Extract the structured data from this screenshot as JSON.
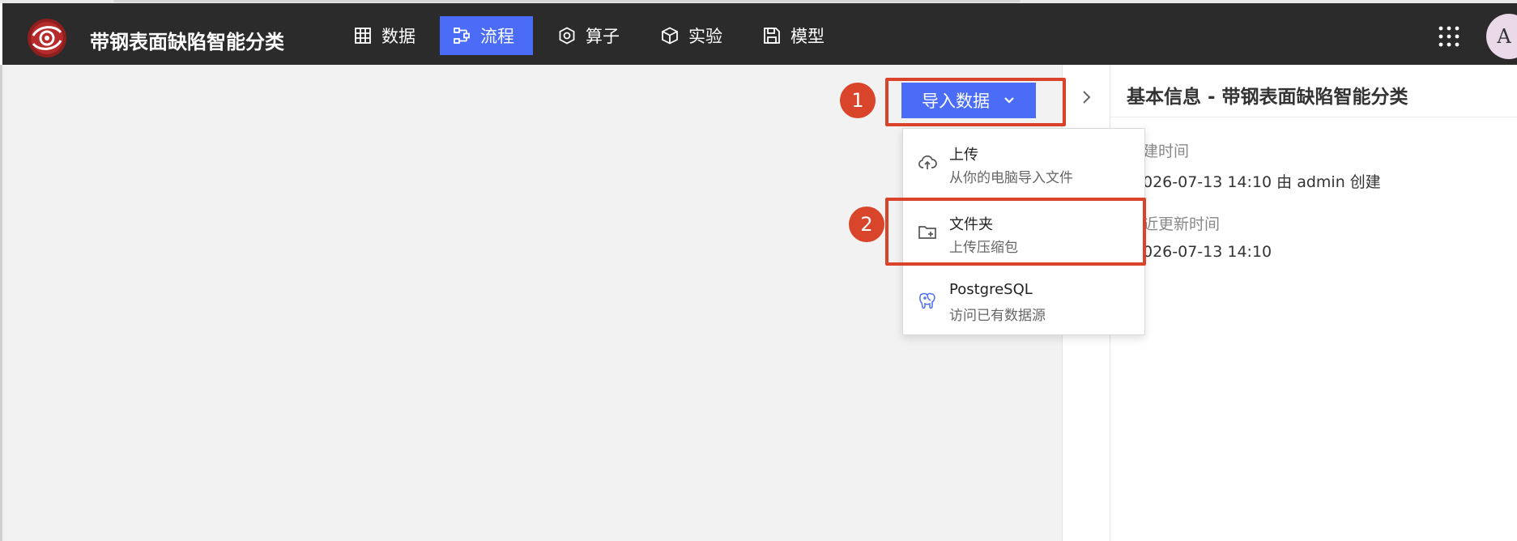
{
  "app": {
    "title": "带钢表面缺陷智能分类"
  },
  "nav": {
    "items": [
      {
        "label": "数据",
        "icon": "table-icon",
        "active": false
      },
      {
        "label": "流程",
        "icon": "flow-icon",
        "active": true
      },
      {
        "label": "算子",
        "icon": "hexagon-icon",
        "active": false
      },
      {
        "label": "实验",
        "icon": "cube-icon",
        "active": false
      },
      {
        "label": "模型",
        "icon": "save-icon",
        "active": false
      }
    ],
    "avatar_initial": "A"
  },
  "toolbar": {
    "import_label": "导入数据"
  },
  "dropdown": {
    "items": [
      {
        "title": "上传",
        "desc": "从你的电脑导入文件",
        "icon": "cloud-upload-icon"
      },
      {
        "title": "文件夹",
        "desc": "上传压缩包",
        "icon": "folder-add-icon"
      },
      {
        "title": "PostgreSQL",
        "desc": "访问已有数据源",
        "icon": "postgresql-icon"
      }
    ]
  },
  "annotations": {
    "step1": "1",
    "step2": "2"
  },
  "panel": {
    "title": "基本信息 - 带钢表面缺陷智能分类",
    "created_label": "建时间",
    "created_value": "026-07-13 14:10  由 admin 创建",
    "updated_label": "近更新时间",
    "updated_value": "026-07-13 14:10"
  },
  "colors": {
    "navbar": "#2b2b2b",
    "accent": "#4a6cf7",
    "highlight": "#d8432a"
  }
}
